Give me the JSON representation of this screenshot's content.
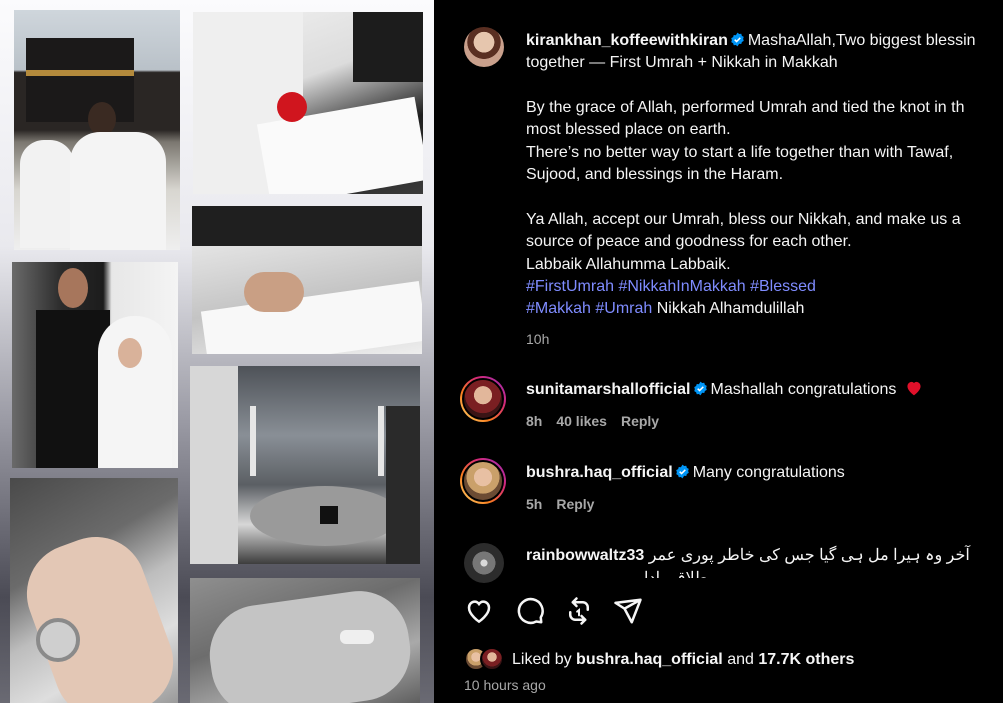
{
  "post": {
    "author": "kirankhan_koffeewithkiran",
    "caption_lines": [
      "MashaAllah,Two biggest blessin",
      "together — First Umrah + Nikkah in Makkah",
      "By the grace of Allah, performed Umrah and tied the knot in th",
      "most blessed place on earth.",
      "There’s no better way to start a life together than with Tawaf,",
      "Sujood, and blessings in the Haram.",
      "Ya Allah, accept our Umrah, bless our Nikkah, and make us a",
      "source of peace and goodness for each other.",
      "Labbaik Allahumma Labbaik."
    ],
    "hashtags_line1": [
      "#FirstUmrah",
      "#NikkahInMakkah",
      "#Blessed"
    ],
    "hashtags_line2": [
      "#Makkah",
      "#Umrah"
    ],
    "hashtags_line2_suffix": "Nikkah Alhamdulillah",
    "time": "10h"
  },
  "comments": [
    {
      "user": "sunitamarshallofficial",
      "text": "Mashallah congratulations",
      "time": "8h",
      "likes": "40 likes",
      "reply": "Reply"
    },
    {
      "user": "bushra.haq_official",
      "text": "Many congratulations",
      "time": "5h",
      "reply": "Reply"
    },
    {
      "user": "rainbowwaltz33",
      "text": "آخر وہ ہیرا مل ہی گیا جس کی خاطر پوری عمر",
      "text2": "طلاقی ادا"
    }
  ],
  "actions": [
    "heart-icon",
    "comment-icon",
    "repost-icon",
    "share-icon"
  ],
  "likes": {
    "prefix": "Liked by",
    "user": "bushra.haq_official",
    "middle": "and",
    "others": "17.7K others"
  },
  "timestamp": "10 hours ago",
  "colors": {
    "hashtag": "#7f8cff",
    "verified": "#0095f6",
    "heart": "#ff3040",
    "muted": "#a8a8a8"
  }
}
